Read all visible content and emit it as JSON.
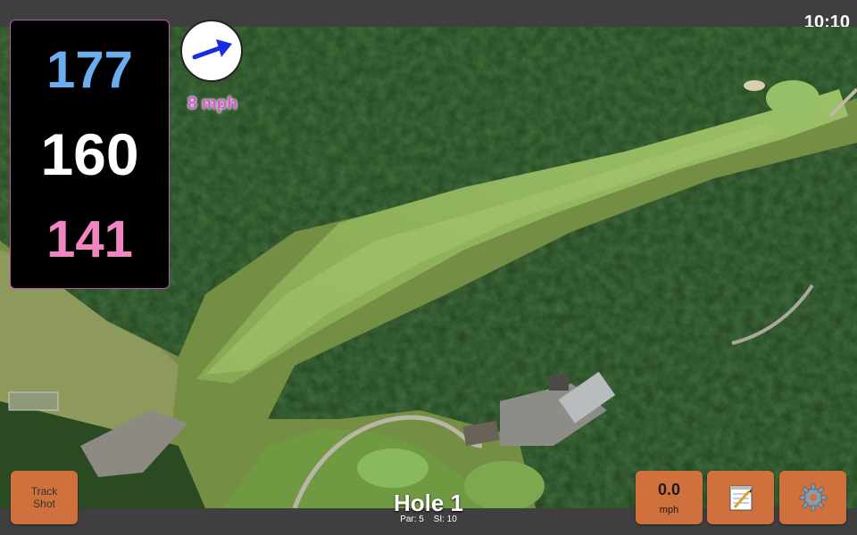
{
  "status": {
    "time": "10:10"
  },
  "distances": {
    "back": "177",
    "middle": "160",
    "front": "141"
  },
  "wind": {
    "speed": "8 mph",
    "icon": "wind-arrow-icon"
  },
  "track_button": {
    "label_line1": "Track",
    "label_line2": "Shot"
  },
  "speed_button": {
    "value": "0.0",
    "unit": "mph"
  },
  "notes_button": {
    "icon": "notepad-icon"
  },
  "settings_button": {
    "icon": "gear-icon"
  },
  "hole": {
    "title": "Hole 1",
    "par": "Par: 5",
    "si": "SI: 10"
  },
  "colors": {
    "back": "#6aaef0",
    "middle": "#ffffff",
    "front": "#ef86c2",
    "wind_text": "#d45ad0",
    "button": "#d0703c"
  }
}
